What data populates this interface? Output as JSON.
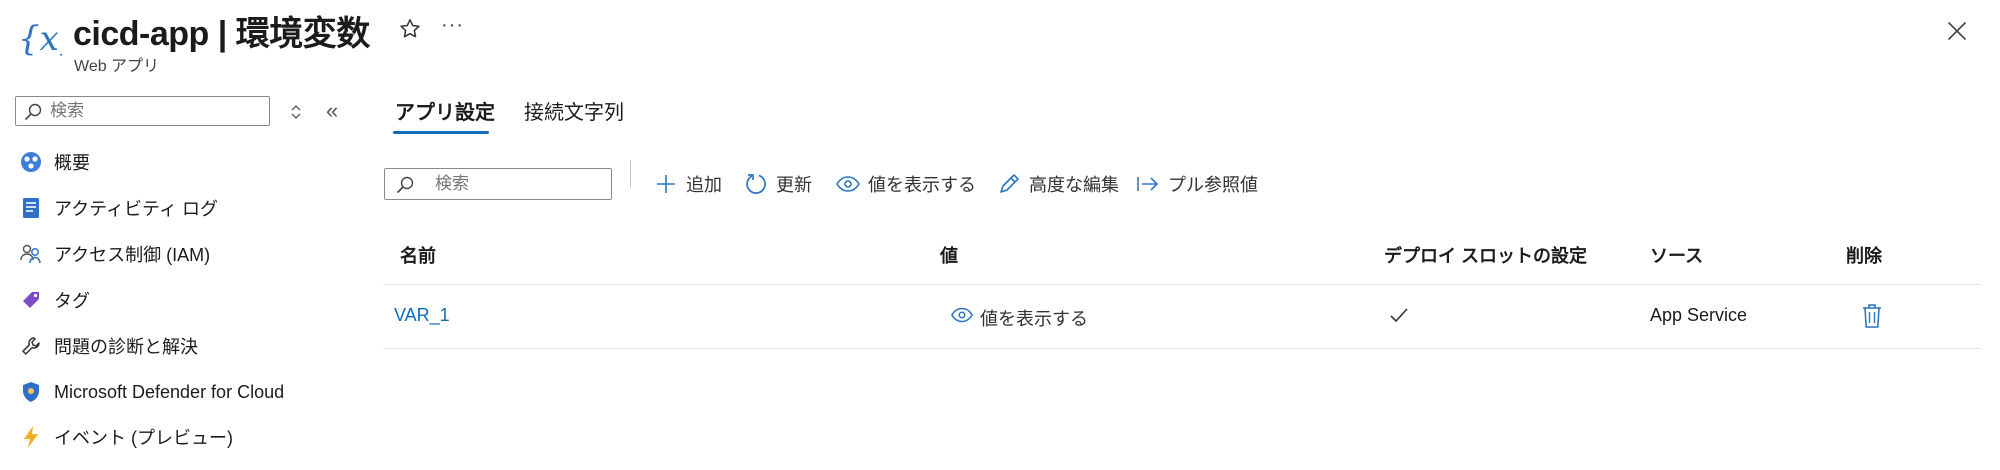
{
  "header": {
    "title": "cicd-app | 環境変数",
    "subtitle": "Web アプリ",
    "more_glyph": "···",
    "icons": {
      "app": "variable-braces-icon",
      "favorite": "star-icon",
      "close": "close-icon"
    }
  },
  "sidebar": {
    "search_placeholder": "検索",
    "collapse_glyph": "«",
    "items": [
      {
        "label": "概要",
        "icon": "overview-icon"
      },
      {
        "label": "アクティビティ ログ",
        "icon": "activity-log-icon"
      },
      {
        "label": "アクセス制御 (IAM)",
        "icon": "iam-icon"
      },
      {
        "label": "タグ",
        "icon": "tag-icon"
      },
      {
        "label": "問題の診断と解決",
        "icon": "wrench-icon"
      },
      {
        "label": "Microsoft Defender for Cloud",
        "icon": "defender-shield-icon"
      },
      {
        "label": "イベント (プレビュー)",
        "icon": "lightning-icon"
      }
    ]
  },
  "tabs": [
    {
      "label": "アプリ設定",
      "active": true
    },
    {
      "label": "接続文字列",
      "active": false
    }
  ],
  "toolbar": {
    "search_placeholder": "検索",
    "add": "追加",
    "refresh": "更新",
    "show_values": "値を表示する",
    "advanced_edit": "高度な編集",
    "pull_reference": "プル参照値"
  },
  "table": {
    "columns": [
      "名前",
      "値",
      "デプロイ スロットの設定",
      "ソース",
      "削除"
    ],
    "rows": [
      {
        "name": "VAR_1",
        "value_action": "値を表示する",
        "slot_setting": true,
        "source": "App Service"
      }
    ]
  },
  "colors": {
    "accent": "#0f6cbd",
    "text": "#1b1b1b",
    "divider": "#e1e1e1"
  }
}
